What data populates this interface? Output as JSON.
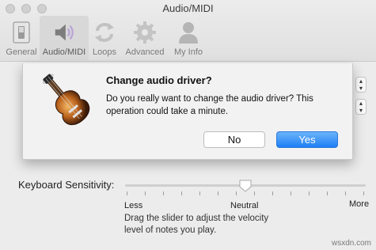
{
  "window": {
    "title": "Audio/MIDI"
  },
  "toolbar": {
    "items": [
      {
        "label": "General",
        "icon": "switch-icon"
      },
      {
        "label": "Audio/MIDI",
        "icon": "speaker-icon",
        "selected": true
      },
      {
        "label": "Loops",
        "icon": "loops-icon"
      },
      {
        "label": "Advanced",
        "icon": "gear-icon"
      },
      {
        "label": "My Info",
        "icon": "person-icon"
      }
    ]
  },
  "dialog": {
    "title": "Change audio driver?",
    "message": "Do you really want to change the audio driver? This operation could take a minute.",
    "no_label": "No",
    "yes_label": "Yes",
    "default_button": "Yes",
    "icon": "guitar-icon"
  },
  "keyboard": {
    "label": "Keyboard Sensitivity:",
    "slider_value": 0.5,
    "less_label": "Less",
    "neutral_label": "Neutral",
    "more_label": "More",
    "help": "Drag the slider to adjust the velocity level of notes you play."
  },
  "watermark": "wsxdn.com",
  "colors": {
    "accent": "#1e7ff5"
  }
}
